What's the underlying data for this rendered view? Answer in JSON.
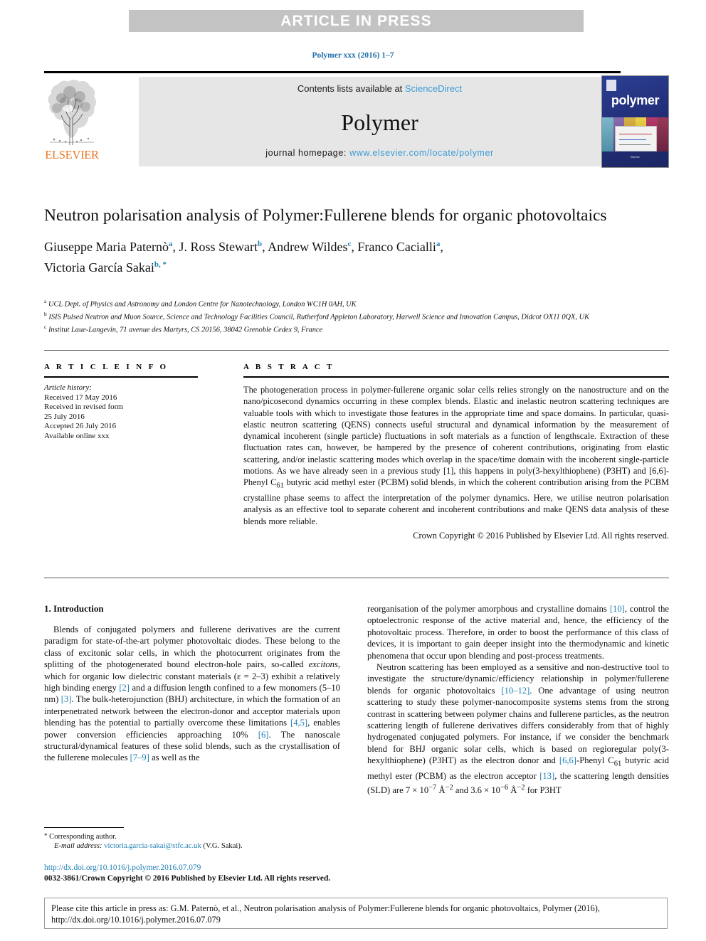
{
  "banner": {
    "text": "ARTICLE IN PRESS"
  },
  "running_head": {
    "text": "Polymer xxx (2016) 1–7"
  },
  "masthead": {
    "contents_prefix": "Contents lists available at ",
    "sciencedirect": "ScienceDirect",
    "journal_name": "Polymer",
    "homepage_label": "journal homepage: ",
    "homepage_url": "www.elsevier.com/locate/polymer",
    "publisher_wordmark": "ELSEVIER",
    "publisher_color": "#e87722",
    "link_color": "#3a9bd5"
  },
  "cover": {
    "title": "polymer",
    "footer_text": "Elsevier",
    "background_color": "#2a3a86"
  },
  "article": {
    "title": "Neutron polarisation analysis of Polymer:Fullerene blends for organic photovoltaics",
    "authors": [
      {
        "name": "Giuseppe Maria Paternò",
        "marks": "a",
        "sep": ", "
      },
      {
        "name": "J. Ross Stewart",
        "marks": "b",
        "sep": ", "
      },
      {
        "name": "Andrew Wildes",
        "marks": "c",
        "sep": ", "
      },
      {
        "name": "Franco Cacialli",
        "marks": "a",
        "sep": ","
      },
      {
        "name": "Victoria García Sakai",
        "marks": "b, *",
        "sep": ""
      }
    ],
    "affiliations": [
      {
        "mark": "a",
        "text": "UCL Dept. of Physics and Astronomy and London Centre for Nanotechnology, London WC1H 0AH, UK"
      },
      {
        "mark": "b",
        "text": "ISIS Pulsed Neutron and Muon Source, Science and Technology Facilities Council, Rutherford Appleton Laboratory, Harwell Science and Innovation Campus, Didcot OX11 0QX, UK"
      },
      {
        "mark": "c",
        "text": "Institut Laue-Langevin, 71 avenue des Martyrs, CS 20156, 38042 Grenoble Cedex 9, France"
      }
    ]
  },
  "article_info": {
    "heading": "A R T I C L E  I N F O",
    "history_label": "Article history:",
    "lines": [
      "Received 17 May 2016",
      "Received in revised form",
      "25 July 2016",
      "Accepted 26 July 2016",
      "Available online xxx"
    ]
  },
  "abstract": {
    "heading": "A B S T R A C T",
    "body": "The photogeneration process in polymer-fullerene organic solar cells relies strongly on the nanostructure and on the nano/picosecond dynamics occurring in these complex blends. Elastic and inelastic neutron scattering techniques are valuable tools with which to investigate those features in the appropriate time and space domains. In particular, quasi-elastic neutron scattering (QENS) connects useful structural and dynamical information by the measurement of dynamical incoherent (single particle) fluctuations in soft materials as a function of lengthscale. Extraction of these fluctuation rates can, however, be hampered by the presence of coherent contributions, originating from elastic scattering, and/or inelastic scattering modes which overlap in the space/time domain with the incoherent single-particle motions. As we have already seen in a previous study [1], this happens in poly(3-hexylthiophene) (P3HT) and [6,6]-Phenyl C61 butyric acid methyl ester (PCBM) solid blends, in which the coherent contribution arising from the PCBM crystalline phase seems to affect the interpretation of the polymer dynamics. Here, we utilise neutron polarisation analysis as an effective tool to separate coherent and incoherent contributions and make QENS data analysis of these blends more reliable.",
    "copyright": "Crown Copyright © 2016 Published by Elsevier Ltd. All rights reserved."
  },
  "body": {
    "section_heading": "1. Introduction",
    "left_paragraph_1": "Blends of conjugated polymers and fullerene derivatives are the current paradigm for state-of-the-art polymer photovoltaic diodes. These belong to the class of excitonic solar cells, in which the photocurrent originates from the splitting of the photogenerated bound electron-hole pairs, so-called excitons, which for organic low dielectric constant materials (ε = 2–3) exhibit a relatively high binding energy [2] and a diffusion length confined to a few monomers (5–10 nm) [3]. The bulk-heterojunction (BHJ) architecture, in which the formation of an interpenetrated network between the electron-donor and acceptor materials upon blending has the potential to partially overcome these limitations [4,5], enables power conversion efficiencies approaching 10% [6]. The nanoscale structural/dynamical features of these solid blends, such as the crystallisation of the fullerene molecules [7–9] as well as the",
    "right_paragraph_1": "reorganisation of the polymer amorphous and crystalline domains [10], control the optoelectronic response of the active material and, hence, the efficiency of the photovoltaic process. Therefore, in order to boost the performance of this class of devices, it is important to gain deeper insight into the thermodynamic and kinetic phenomena that occur upon blending and post-process treatments.",
    "right_paragraph_2": "Neutron scattering has been employed as a sensitive and non-destructive tool to investigate the structure/dynamic/efficiency relationship in polymer/fullerene blends for organic photovoltaics [10–12]. One advantage of using neutron scattering to study these polymer-nanocomposite systems stems from the strong contrast in scattering between polymer chains and fullerene particles, as the neutron scattering length of fullerene derivatives differs considerably from that of highly hydrogenated conjugated polymers. For instance, if we consider the benchmark blend for BHJ organic solar cells, which is based on regioregular poly(3-hexylthiophene) (P3HT) as the electron donor and [6,6]-Phenyl C61 butyric acid methyl ester (PCBM) as the electron acceptor [13], the scattering length densities (SLD) are 7 × 10−7 Å−2 and 3.6 × 10−6 Å−2 for P3HT"
  },
  "footer": {
    "corresponding_label": "Corresponding author.",
    "email_label": "E-mail address:",
    "email": "victoria.garcia-sakai@stfc.ac.uk",
    "email_suffix": "(V.G. Sakai).",
    "doi_url": "http://dx.doi.org/10.1016/j.polymer.2016.07.079",
    "issn_line": "0032-3861/Crown Copyright © 2016 Published by Elsevier Ltd. All rights reserved."
  },
  "cite_box": {
    "text": "Please cite this article in press as: G.M. Paternò, et al., Neutron polarisation analysis of Polymer:Fullerene blends for organic photovoltaics, Polymer (2016), http://dx.doi.org/10.1016/j.polymer.2016.07.079"
  }
}
